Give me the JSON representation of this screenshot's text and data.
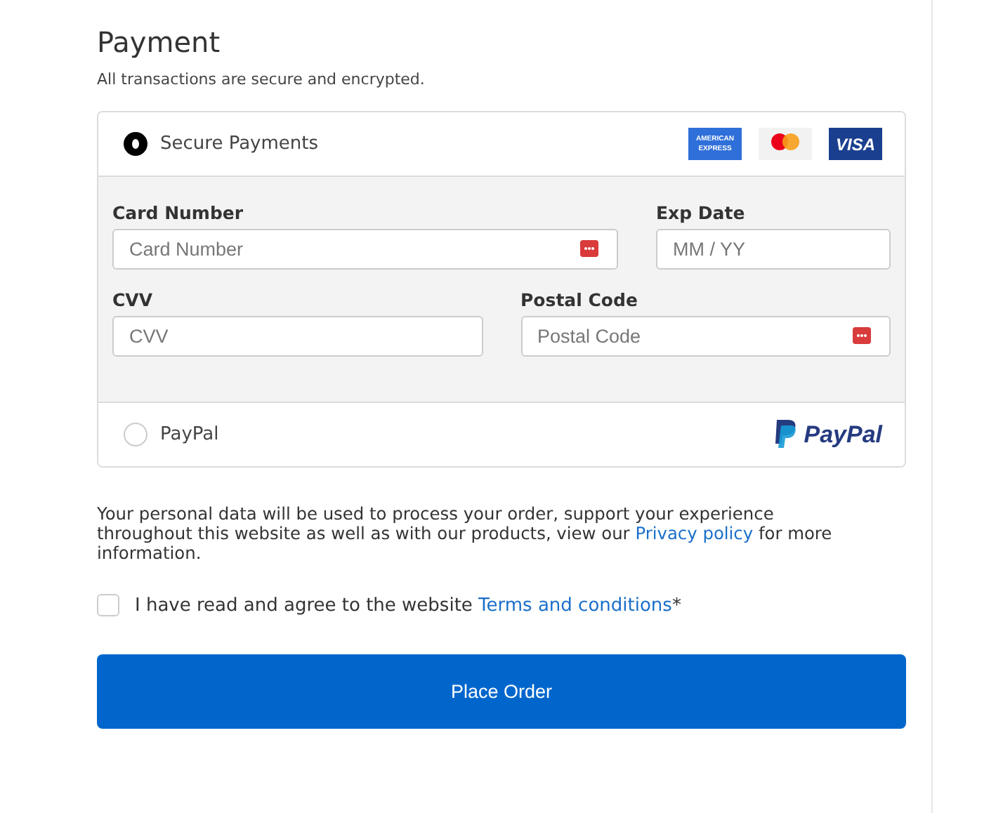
{
  "title": "Payment",
  "subtitle": "All transactions are secure and encrypted.",
  "methods": [
    {
      "kind": "card",
      "label": "Secure Payments",
      "selected": true,
      "logos": [
        {
          "kind": "amex",
          "text": "AMERICAN EXPRESS"
        },
        {
          "kind": "mastercard"
        },
        {
          "kind": "visa",
          "text": "VISA"
        }
      ]
    },
    {
      "kind": "paypal",
      "label": "PayPal",
      "selected": false,
      "logos": [
        {
          "kind": "paypal",
          "text": "PayPal"
        }
      ]
    }
  ],
  "card_fields": [
    [
      {
        "label": "Card Number",
        "placeholder": "Card Number",
        "kind": "with-icon"
      },
      {
        "label": "Exp Date",
        "placeholder": "MM / YY",
        "kind": "plain"
      }
    ],
    [
      {
        "label": "CVV",
        "placeholder": "CVV",
        "kind": "plain"
      },
      {
        "label": "Postal Code",
        "placeholder": "Postal Code",
        "kind": "with-icon"
      }
    ]
  ],
  "privacy": {
    "before": "Your personal data will be used to process your order, support your experience throughout this website as well as with our products, view our ",
    "link": "Privacy policy",
    "after": " for more information."
  },
  "terms": {
    "checked": false,
    "before": "I have read and agree to the website ",
    "link": "Terms and conditions",
    "after": "*"
  },
  "button": "Place Order"
}
